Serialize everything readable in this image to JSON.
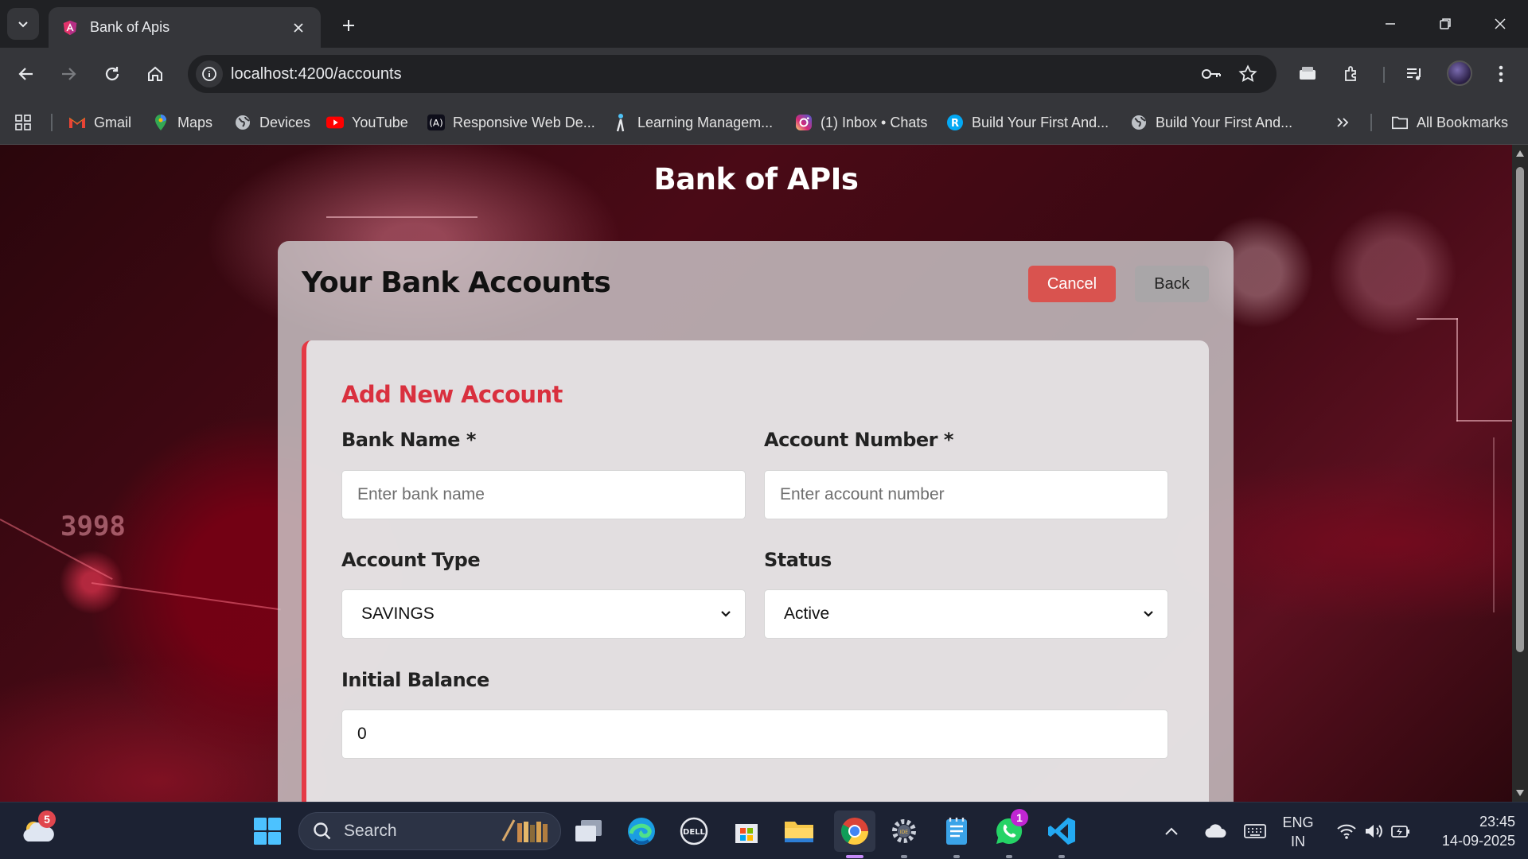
{
  "browser": {
    "tab": {
      "title": "Bank of Apis"
    },
    "url": "localhost:4200/accounts",
    "bookmarks": [
      {
        "label": "Gmail",
        "icon": "gmail-icon"
      },
      {
        "label": "Maps",
        "icon": "maps-icon"
      },
      {
        "label": "Devices",
        "icon": "globe-icon"
      },
      {
        "label": "YouTube",
        "icon": "youtube-icon"
      },
      {
        "label": "Responsive Web De...",
        "icon": "angular-icon"
      },
      {
        "label": "Learning Managem...",
        "icon": "person-icon"
      },
      {
        "label": "(1) Inbox • Chats",
        "icon": "instagram-icon"
      },
      {
        "label": "Build Your First And...",
        "icon": "site-icon"
      },
      {
        "label": "Build Your First And...",
        "icon": "globe-icon"
      }
    ],
    "all_bookmarks": "All Bookmarks"
  },
  "page": {
    "app_title": "Bank of APIs",
    "section_title": "Your Bank Accounts",
    "cancel_label": "Cancel",
    "back_label": "Back",
    "background_number": "3998",
    "form": {
      "title": "Add New Account",
      "bank_name_label": "Bank Name *",
      "bank_name_placeholder": "Enter bank name",
      "account_number_label": "Account Number *",
      "account_number_placeholder": "Enter account number",
      "account_type_label": "Account Type",
      "account_type_value": "SAVINGS",
      "status_label": "Status",
      "status_value": "Active",
      "initial_balance_label": "Initial Balance",
      "initial_balance_value": "0"
    }
  },
  "taskbar": {
    "weather_badge": "5",
    "search_label": "Search",
    "whatsapp_badge": "1",
    "language": "ENG",
    "region": "IN",
    "time": "23:45",
    "date": "14-09-2025"
  },
  "colors": {
    "accent_red": "#d9303e",
    "cancel_bg": "#d9534f",
    "card_border": "#e53945"
  }
}
